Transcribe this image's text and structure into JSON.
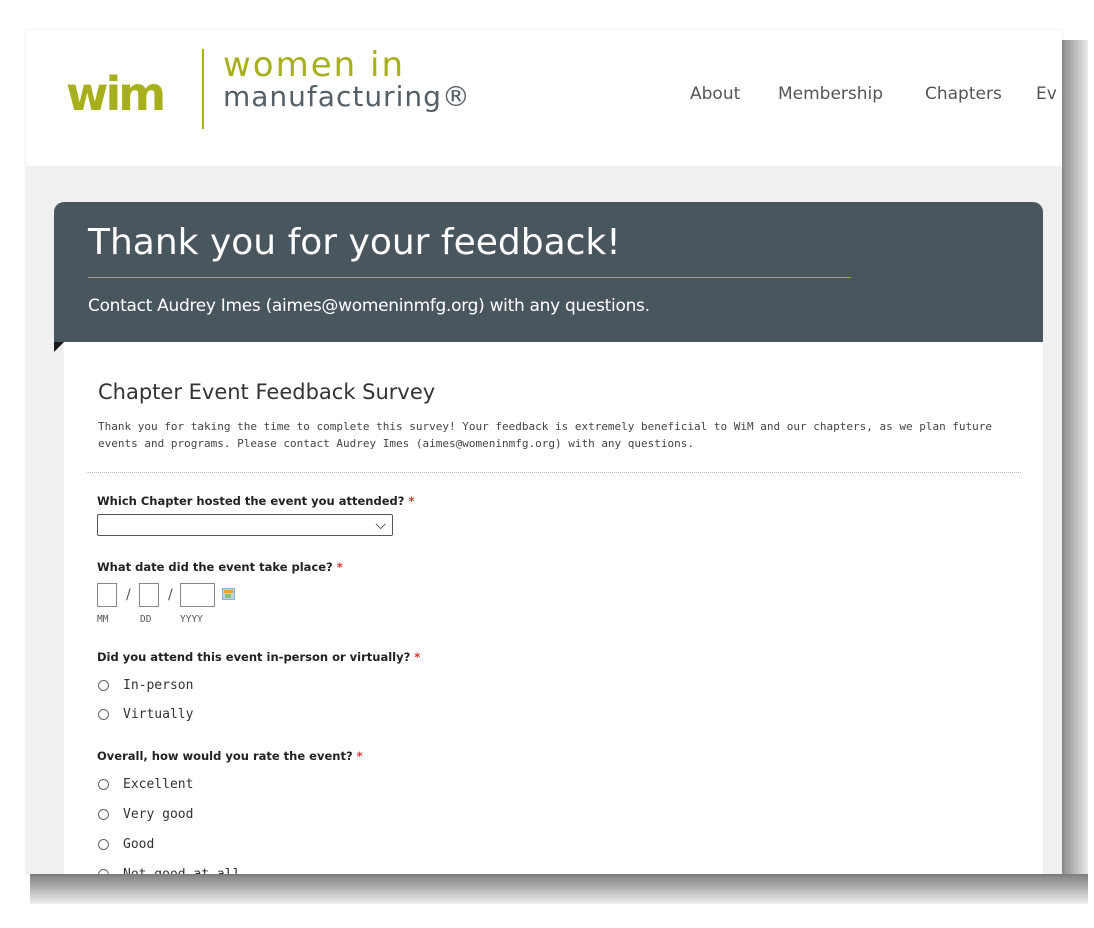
{
  "header": {
    "logo_mark": "wim",
    "logo_line1": "women in",
    "logo_line2": "manufacturing®",
    "nav": [
      "About",
      "Membership",
      "Chapters",
      "Ev"
    ]
  },
  "banner": {
    "title": "Thank you for your feedback!",
    "subtitle": "Contact Audrey Imes (aimes@womeninmfg.org) with any questions."
  },
  "form": {
    "title": "Chapter Event Feedback Survey",
    "intro": "Thank you for taking the time to complete this survey! Your feedback is extremely beneficial to WiM and our chapters, as we plan future events and programs. Please contact Audrey Imes (aimes@womeninmfg.org) with any questions.",
    "required_mark": "*",
    "q1": {
      "label": "Which Chapter hosted the event you attended?",
      "value": ""
    },
    "q2": {
      "label": "What date did the event take place?",
      "separator": "/",
      "hints": [
        "MM",
        "DD",
        "YYYY"
      ]
    },
    "q3": {
      "label": "Did you attend this event in-person or virtually?",
      "options": [
        "In-person",
        "Virtually"
      ]
    },
    "q4": {
      "label": "Overall, how would you rate the event?",
      "options": [
        "Excellent",
        "Very good",
        "Good",
        "Not good at all"
      ]
    }
  },
  "colors": {
    "brand_green": "#a7b01c",
    "banner_bg": "#49565e",
    "required": "#e03030"
  },
  "icons": [
    "calendar-icon",
    "chevron-down-icon"
  ]
}
